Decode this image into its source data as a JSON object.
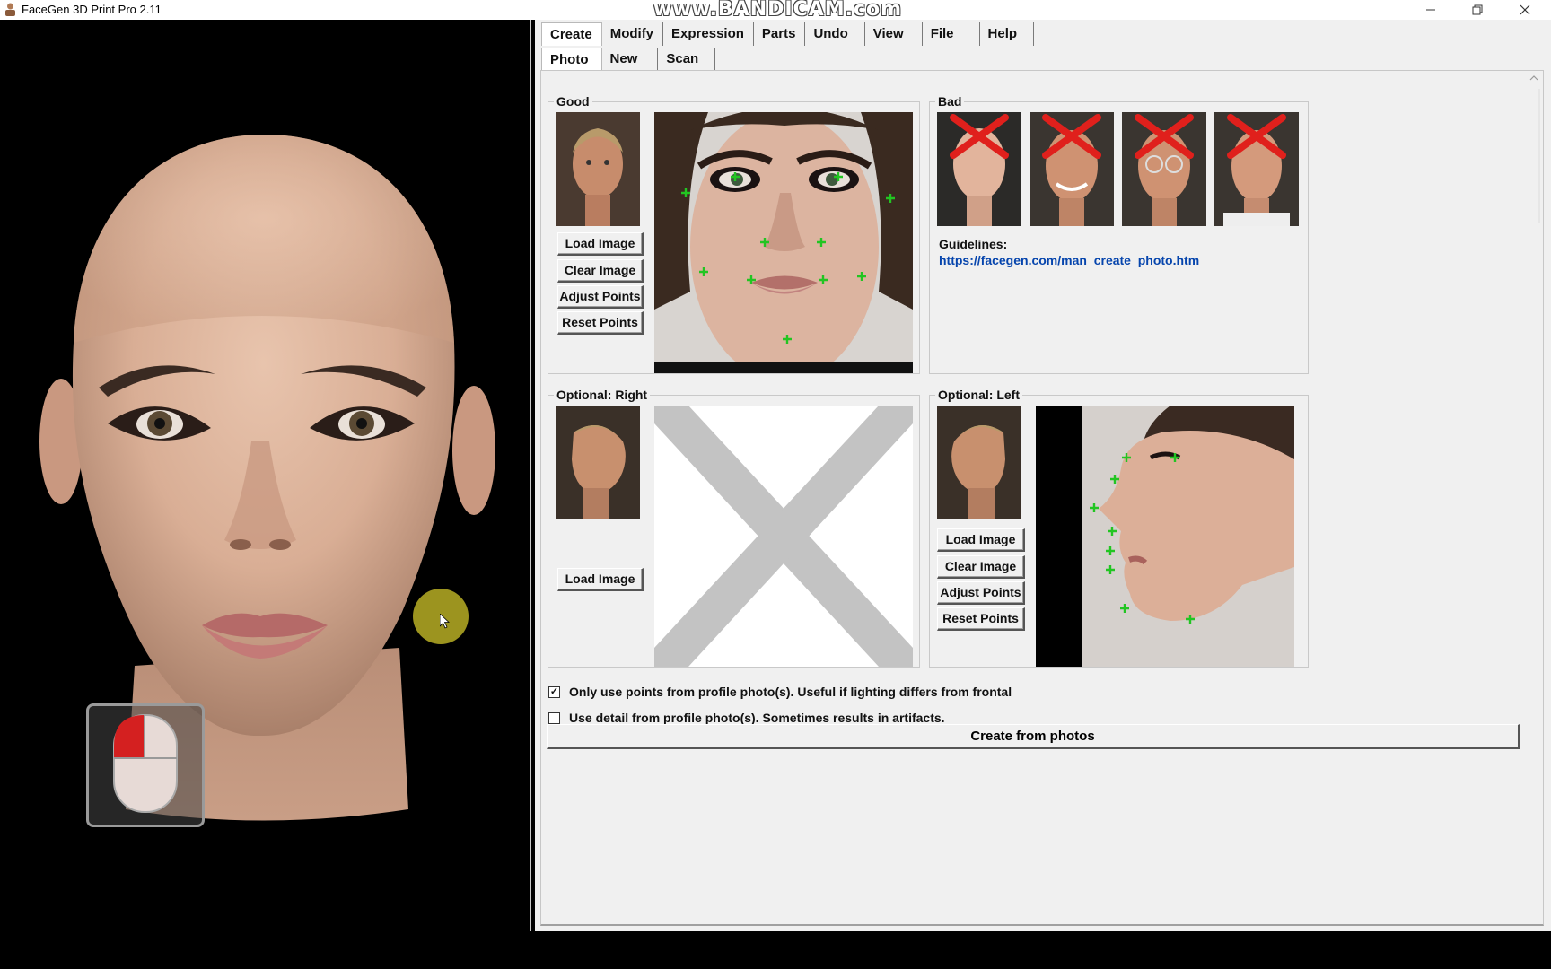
{
  "window": {
    "title": "FaceGen 3D Print Pro 2.11",
    "watermark": "www.BANDICAM.com",
    "controls": [
      "minimize",
      "restore",
      "close"
    ]
  },
  "menu_tabs": [
    {
      "label": "Create",
      "active": true
    },
    {
      "label": "Modify",
      "active": false
    },
    {
      "label": "Expression",
      "active": false
    },
    {
      "label": "Parts",
      "active": false
    },
    {
      "label": "Undo",
      "active": false
    },
    {
      "label": "View",
      "active": false
    },
    {
      "label": "File",
      "active": false
    },
    {
      "label": "Help",
      "active": false
    }
  ],
  "sub_tabs": [
    {
      "label": "Photo",
      "active": true
    },
    {
      "label": "New",
      "active": false
    },
    {
      "label": "Scan",
      "active": false
    }
  ],
  "groups": {
    "good": {
      "label": "Good",
      "buttons": [
        "Load Image",
        "Clear Image",
        "Adjust Points",
        "Reset Points"
      ]
    },
    "bad": {
      "label": "Bad",
      "guidelines_label": "Guidelines:",
      "guidelines_link": "https://facegen.com/man_create_photo.htm"
    },
    "optional_right": {
      "label": "Optional: Right",
      "buttons": [
        "Load Image"
      ]
    },
    "optional_left": {
      "label": "Optional: Left",
      "buttons": [
        "Load Image",
        "Clear Image",
        "Adjust Points",
        "Reset Points"
      ]
    }
  },
  "options": [
    {
      "label": "Only use points from profile photo(s). Useful if lighting differs from frontal",
      "checked": true
    },
    {
      "label": "Use detail from profile photo(s). Sometimes results in artifacts.",
      "checked": false
    }
  ],
  "create_button": "Create from photos",
  "colors": {
    "panel_bg": "#f0f0f0",
    "link": "#0645ad",
    "feature_point": "#22c522",
    "bad_x": "#e0201c",
    "cursor_highlight": "#c8be28"
  }
}
